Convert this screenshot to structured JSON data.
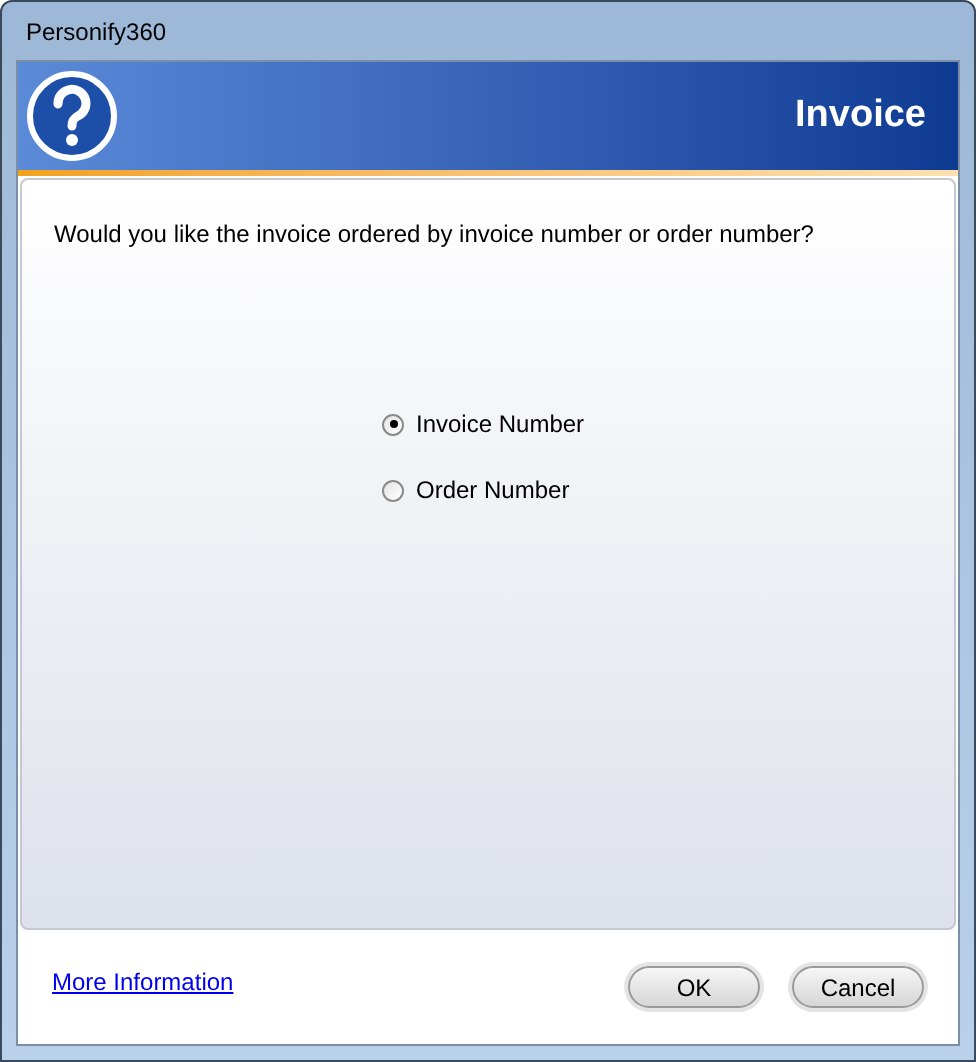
{
  "window": {
    "title": "Personify360"
  },
  "banner": {
    "title": "Invoice"
  },
  "question": "Would you like the invoice ordered by invoice number or order number?",
  "options": [
    {
      "label": "Invoice Number",
      "selected": true
    },
    {
      "label": "Order Number",
      "selected": false
    }
  ],
  "link": "More Information",
  "buttons": [
    "OK",
    "Cancel"
  ]
}
